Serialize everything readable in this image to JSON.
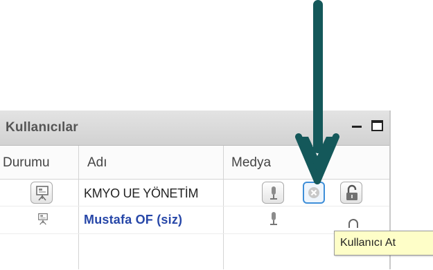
{
  "panel": {
    "title": "Kullanıcılar",
    "columns": {
      "status": "Durumu",
      "name": "Adı",
      "media": "Medya"
    }
  },
  "users": [
    {
      "name": "KMYO UE YÖNETİM"
    },
    {
      "name": "Mustafa OF (siz)"
    }
  ],
  "tooltip": {
    "text": "Kullanıcı At"
  },
  "colors": {
    "arrow": "#14585a",
    "self_name": "#2747a8",
    "kick_highlight": "#3d8ed8",
    "tooltip_bg": "#fefec8"
  },
  "icons": [
    "presentation-icon",
    "microphone-icon",
    "kick-user-icon",
    "unlock-icon"
  ]
}
